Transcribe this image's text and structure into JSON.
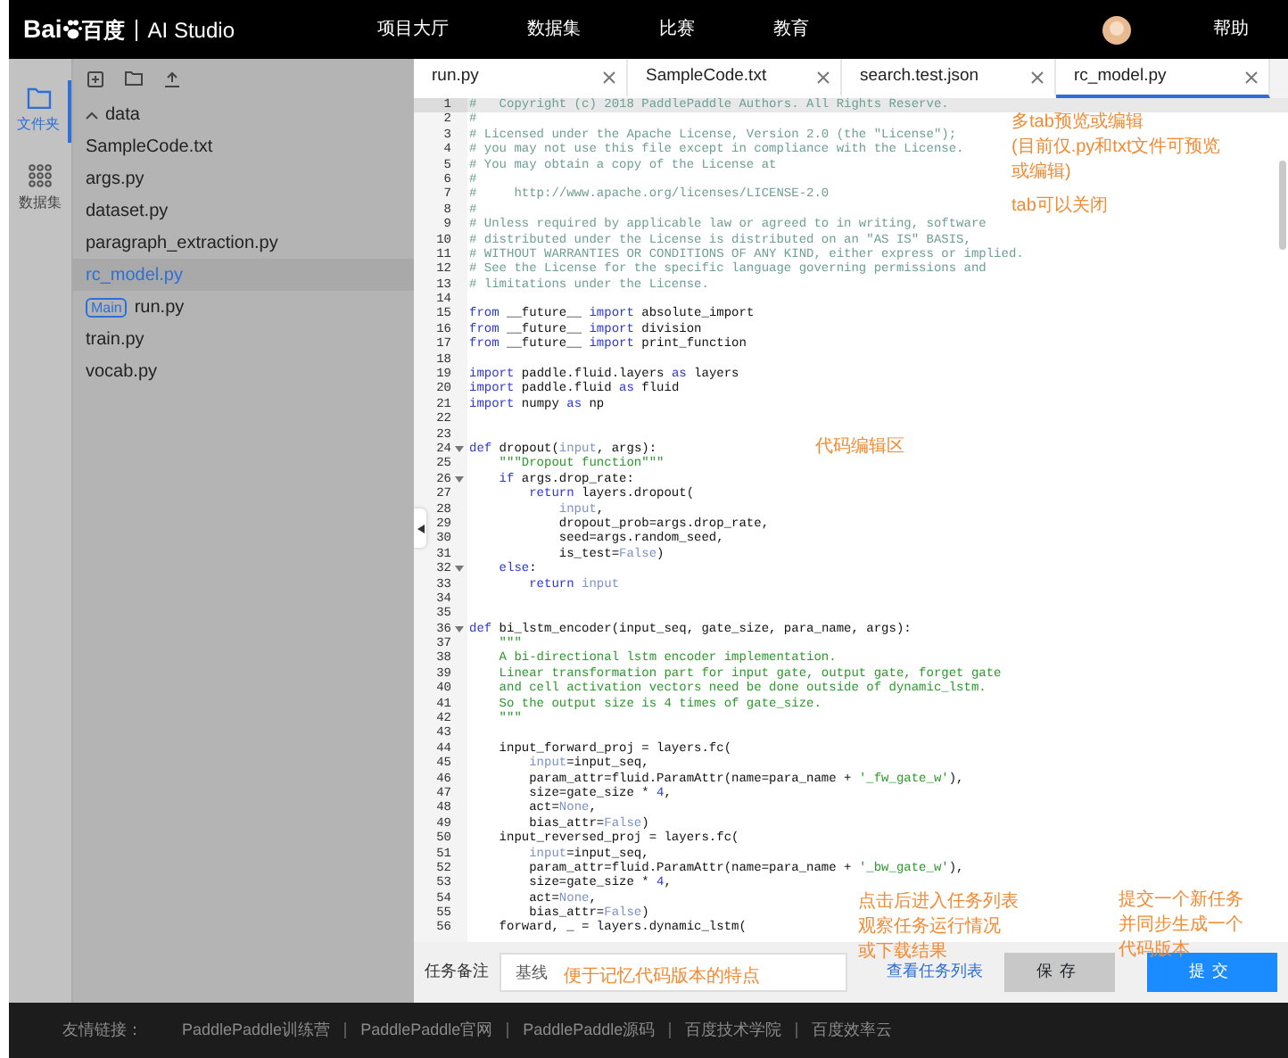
{
  "topbar": {
    "logo": {
      "brand": "Bai",
      "brand_cn": "百度",
      "product": "AI Studio"
    },
    "nav": [
      "项目大厅",
      "数据集",
      "比赛",
      "教育"
    ],
    "help": "帮助"
  },
  "rail": [
    {
      "label": "文件夹",
      "selected": true
    },
    {
      "label": "数据集",
      "selected": false
    }
  ],
  "file_tree": [
    {
      "name": "data",
      "kind": "folder",
      "expanded": true,
      "selected": false
    },
    {
      "name": "SampleCode.txt",
      "kind": "file",
      "selected": false
    },
    {
      "name": "args.py",
      "kind": "file",
      "selected": false
    },
    {
      "name": "dataset.py",
      "kind": "file",
      "selected": false
    },
    {
      "name": "paragraph_extraction.py",
      "kind": "file",
      "selected": false
    },
    {
      "name": "rc_model.py",
      "kind": "file",
      "selected": true
    },
    {
      "name": "run.py",
      "kind": "file",
      "badge": "Main",
      "selected": false
    },
    {
      "name": "train.py",
      "kind": "file",
      "selected": false
    },
    {
      "name": "vocab.py",
      "kind": "file",
      "selected": false
    }
  ],
  "tabs": [
    {
      "label": "run.py",
      "selected": false
    },
    {
      "label": "SampleCode.txt",
      "selected": false
    },
    {
      "label": "search.test.json",
      "selected": false
    },
    {
      "label": "rc_model.py",
      "selected": true
    }
  ],
  "code_lines": [
    {
      "n": "1",
      "active": true,
      "foldable": false,
      "tokens": [
        {
          "kind": "comment",
          "text": "#   Copyright (c) 2018 PaddlePaddle Authors. All Rights Reserve."
        }
      ]
    },
    {
      "n": "2",
      "active": false,
      "foldable": false,
      "tokens": [
        {
          "kind": "comment",
          "text": "#"
        }
      ]
    },
    {
      "n": "3",
      "active": false,
      "foldable": false,
      "tokens": [
        {
          "kind": "comment",
          "text": "# Licensed under the Apache License, Version 2.0 (the \"License\");"
        }
      ]
    },
    {
      "n": "4",
      "active": false,
      "foldable": false,
      "tokens": [
        {
          "kind": "comment",
          "text": "# you may not use this file except in compliance with the License."
        }
      ]
    },
    {
      "n": "5",
      "active": false,
      "foldable": false,
      "tokens": [
        {
          "kind": "comment",
          "text": "# You may obtain a copy of the License at"
        }
      ]
    },
    {
      "n": "6",
      "active": false,
      "foldable": false,
      "tokens": [
        {
          "kind": "comment",
          "text": "#"
        }
      ]
    },
    {
      "n": "7",
      "active": false,
      "foldable": false,
      "tokens": [
        {
          "kind": "comment",
          "text": "#     http://www.apache.org/licenses/LICENSE-2.0"
        }
      ]
    },
    {
      "n": "8",
      "active": false,
      "foldable": false,
      "tokens": [
        {
          "kind": "comment",
          "text": "#"
        }
      ]
    },
    {
      "n": "9",
      "active": false,
      "foldable": false,
      "tokens": [
        {
          "kind": "comment",
          "text": "# Unless required by applicable law or agreed to in writing, software"
        }
      ]
    },
    {
      "n": "10",
      "active": false,
      "foldable": false,
      "tokens": [
        {
          "kind": "comment",
          "text": "# distributed under the License is distributed on an \"AS IS\" BASIS,"
        }
      ]
    },
    {
      "n": "11",
      "active": false,
      "foldable": false,
      "tokens": [
        {
          "kind": "comment",
          "text": "# WITHOUT WARRANTIES OR CONDITIONS OF ANY KIND, either express or implied."
        }
      ]
    },
    {
      "n": "12",
      "active": false,
      "foldable": false,
      "tokens": [
        {
          "kind": "comment",
          "text": "# See the License for the specific language governing permissions and"
        }
      ]
    },
    {
      "n": "13",
      "active": false,
      "foldable": false,
      "tokens": [
        {
          "kind": "comment",
          "text": "# limitations under the License."
        }
      ]
    },
    {
      "n": "14",
      "active": false,
      "foldable": false
    },
    {
      "n": "15",
      "active": false,
      "foldable": false,
      "tokens": [
        {
          "kind": "keyword",
          "text": "from"
        },
        {
          "kind": "plain",
          "text": " __future__ "
        },
        {
          "kind": "keyword",
          "text": "import"
        },
        {
          "kind": "plain",
          "text": " absolute_import"
        }
      ]
    },
    {
      "n": "16",
      "active": false,
      "foldable": false,
      "tokens": [
        {
          "kind": "keyword",
          "text": "from"
        },
        {
          "kind": "plain",
          "text": " __future__ "
        },
        {
          "kind": "keyword",
          "text": "import"
        },
        {
          "kind": "plain",
          "text": " division"
        }
      ]
    },
    {
      "n": "17",
      "active": false,
      "foldable": false,
      "tokens": [
        {
          "kind": "keyword",
          "text": "from"
        },
        {
          "kind": "plain",
          "text": " __future__ "
        },
        {
          "kind": "keyword",
          "text": "import"
        },
        {
          "kind": "plain",
          "text": " print_function"
        }
      ]
    },
    {
      "n": "18",
      "active": false,
      "foldable": false
    },
    {
      "n": "19",
      "active": false,
      "foldable": false,
      "tokens": [
        {
          "kind": "keyword",
          "text": "import"
        },
        {
          "kind": "plain",
          "text": " paddle.fluid.layers "
        },
        {
          "kind": "keyword",
          "text": "as"
        },
        {
          "kind": "plain",
          "text": " layers"
        }
      ]
    },
    {
      "n": "20",
      "active": false,
      "foldable": false,
      "tokens": [
        {
          "kind": "keyword",
          "text": "import"
        },
        {
          "kind": "plain",
          "text": " paddle.fluid "
        },
        {
          "kind": "keyword",
          "text": "as"
        },
        {
          "kind": "plain",
          "text": " fluid"
        }
      ]
    },
    {
      "n": "21",
      "active": false,
      "foldable": false,
      "tokens": [
        {
          "kind": "keyword",
          "text": "import"
        },
        {
          "kind": "plain",
          "text": " numpy "
        },
        {
          "kind": "keyword",
          "text": "as"
        },
        {
          "kind": "plain",
          "text": " np"
        }
      ]
    },
    {
      "n": "22",
      "active": false,
      "foldable": false
    },
    {
      "n": "23",
      "active": false,
      "foldable": false
    },
    {
      "n": "24",
      "active": false,
      "foldable": true,
      "tokens": [
        {
          "kind": "keyword",
          "text": "def"
        },
        {
          "kind": "plain",
          "text": " dropout("
        },
        {
          "kind": "builtin",
          "text": "input"
        },
        {
          "kind": "plain",
          "text": ", args):"
        }
      ]
    },
    {
      "n": "25",
      "active": false,
      "foldable": false,
      "tokens": [
        {
          "kind": "string",
          "text": "    \"\"\"Dropout function\"\"\""
        }
      ]
    },
    {
      "n": "26",
      "active": false,
      "foldable": true,
      "tokens": [
        {
          "kind": "keyword",
          "text": "    if"
        },
        {
          "kind": "plain",
          "text": " args.drop_rate:"
        }
      ]
    },
    {
      "n": "27",
      "active": false,
      "foldable": false,
      "tokens": [
        {
          "kind": "keyword",
          "text": "        return"
        },
        {
          "kind": "plain",
          "text": " layers.dropout("
        }
      ]
    },
    {
      "n": "28",
      "active": false,
      "foldable": false,
      "tokens": [
        {
          "kind": "builtin",
          "text": "            input"
        },
        {
          "kind": "plain",
          "text": ","
        }
      ]
    },
    {
      "n": "29",
      "active": false,
      "foldable": false,
      "tokens": [
        {
          "kind": "plain",
          "text": "            dropout_prob=args.drop_rate,"
        }
      ]
    },
    {
      "n": "30",
      "active": false,
      "foldable": false,
      "tokens": [
        {
          "kind": "plain",
          "text": "            seed=args.random_seed,"
        }
      ]
    },
    {
      "n": "31",
      "active": false,
      "foldable": false,
      "tokens": [
        {
          "kind": "plain",
          "text": "            is_test="
        },
        {
          "kind": "builtin",
          "text": "False"
        },
        {
          "kind": "plain",
          "text": ")"
        }
      ]
    },
    {
      "n": "32",
      "active": false,
      "foldable": true,
      "tokens": [
        {
          "kind": "keyword",
          "text": "    else"
        },
        {
          "kind": "plain",
          "text": ":"
        }
      ]
    },
    {
      "n": "33",
      "active": false,
      "foldable": false,
      "tokens": [
        {
          "kind": "keyword",
          "text": "        return "
        },
        {
          "kind": "builtin",
          "text": "input"
        }
      ]
    },
    {
      "n": "34",
      "active": false,
      "foldable": false
    },
    {
      "n": "35",
      "active": false,
      "foldable": false
    },
    {
      "n": "36",
      "active": false,
      "foldable": true,
      "tokens": [
        {
          "kind": "keyword",
          "text": "def"
        },
        {
          "kind": "plain",
          "text": " bi_lstm_encoder(input_seq, gate_size, para_name, args):"
        }
      ]
    },
    {
      "n": "37",
      "active": false,
      "foldable": false,
      "tokens": [
        {
          "kind": "string",
          "text": "    \"\"\""
        }
      ]
    },
    {
      "n": "38",
      "active": false,
      "foldable": false,
      "tokens": [
        {
          "kind": "string",
          "text": "    A bi-directional lstm encoder implementation."
        }
      ]
    },
    {
      "n": "39",
      "active": false,
      "foldable": false,
      "tokens": [
        {
          "kind": "string",
          "text": "    Linear transformation part for input gate, output gate, forget gate"
        }
      ]
    },
    {
      "n": "40",
      "active": false,
      "foldable": false,
      "tokens": [
        {
          "kind": "string",
          "text": "    and cell activation vectors need be done outside of dynamic_lstm."
        }
      ]
    },
    {
      "n": "41",
      "active": false,
      "foldable": false,
      "tokens": [
        {
          "kind": "string",
          "text": "    So the output size is 4 times of gate_size."
        }
      ]
    },
    {
      "n": "42",
      "active": false,
      "foldable": false,
      "tokens": [
        {
          "kind": "string",
          "text": "    \"\"\""
        }
      ]
    },
    {
      "n": "43",
      "active": false,
      "foldable": false
    },
    {
      "n": "44",
      "active": false,
      "foldable": false,
      "tokens": [
        {
          "kind": "plain",
          "text": "    input_forward_proj = layers.fc("
        }
      ]
    },
    {
      "n": "45",
      "active": false,
      "foldable": false,
      "tokens": [
        {
          "kind": "builtin",
          "text": "        input"
        },
        {
          "kind": "plain",
          "text": "=input_seq,"
        }
      ]
    },
    {
      "n": "46",
      "active": false,
      "foldable": false,
      "tokens": [
        {
          "kind": "plain",
          "text": "        param_attr=fluid.ParamAttr(name=para_name + "
        },
        {
          "kind": "string",
          "text": "'_fw_gate_w'"
        },
        {
          "kind": "plain",
          "text": "),"
        }
      ]
    },
    {
      "n": "47",
      "active": false,
      "foldable": false,
      "tokens": [
        {
          "kind": "plain",
          "text": "        size=gate_size * "
        },
        {
          "kind": "number",
          "text": "4"
        },
        {
          "kind": "plain",
          "text": ","
        }
      ]
    },
    {
      "n": "48",
      "active": false,
      "foldable": false,
      "tokens": [
        {
          "kind": "plain",
          "text": "        act="
        },
        {
          "kind": "builtin",
          "text": "None"
        },
        {
          "kind": "plain",
          "text": ","
        }
      ]
    },
    {
      "n": "49",
      "active": false,
      "foldable": false,
      "tokens": [
        {
          "kind": "plain",
          "text": "        bias_attr="
        },
        {
          "kind": "builtin",
          "text": "False"
        },
        {
          "kind": "plain",
          "text": ")"
        }
      ]
    },
    {
      "n": "50",
      "active": false,
      "foldable": false,
      "tokens": [
        {
          "kind": "plain",
          "text": "    input_reversed_proj = layers.fc("
        }
      ]
    },
    {
      "n": "51",
      "active": false,
      "foldable": false,
      "tokens": [
        {
          "kind": "builtin",
          "text": "        input"
        },
        {
          "kind": "plain",
          "text": "=input_seq,"
        }
      ]
    },
    {
      "n": "52",
      "active": false,
      "foldable": false,
      "tokens": [
        {
          "kind": "plain",
          "text": "        param_attr=fluid.ParamAttr(name=para_name + "
        },
        {
          "kind": "string",
          "text": "'_bw_gate_w'"
        },
        {
          "kind": "plain",
          "text": "),"
        }
      ]
    },
    {
      "n": "53",
      "active": false,
      "foldable": false,
      "tokens": [
        {
          "kind": "plain",
          "text": "        size=gate_size * "
        },
        {
          "kind": "number",
          "text": "4"
        },
        {
          "kind": "plain",
          "text": ","
        }
      ]
    },
    {
      "n": "54",
      "active": false,
      "foldable": false,
      "tokens": [
        {
          "kind": "plain",
          "text": "        act="
        },
        {
          "kind": "builtin",
          "text": "None"
        },
        {
          "kind": "plain",
          "text": ","
        }
      ]
    },
    {
      "n": "55",
      "active": false,
      "foldable": false,
      "tokens": [
        {
          "kind": "plain",
          "text": "        bias_attr="
        },
        {
          "kind": "builtin",
          "text": "False"
        },
        {
          "kind": "plain",
          "text": ")"
        }
      ]
    },
    {
      "n": "56",
      "active": false,
      "foldable": false,
      "tokens": [
        {
          "kind": "plain",
          "text": "    forward, _ = layers.dynamic_lstm("
        }
      ]
    }
  ],
  "task_bar": {
    "label": "任务备注",
    "note_value": "基线",
    "link": "查看任务列表",
    "buttons": [
      {
        "label": "保存",
        "kind": "save",
        "disabled": true
      },
      {
        "label": "提交",
        "kind": "submit",
        "disabled": false
      }
    ]
  },
  "footer": {
    "label": "友情链接：",
    "links": [
      "PaddlePaddle训练营",
      "PaddlePaddle官网",
      "PaddlePaddle源码",
      "百度技术学院",
      "百度效率云"
    ]
  },
  "annotations": [
    {
      "lines": [
        "多tab预览或编辑",
        "(目前仅.py和txt文件可预览",
        "或编辑)"
      ]
    },
    {
      "lines": [
        "tab可以关闭"
      ]
    },
    {
      "lines": [
        "代码编辑区"
      ]
    },
    {
      "lines": [
        "点击后进入任务列表",
        "观察任务运行情况",
        "或下载结果"
      ]
    },
    {
      "lines": [
        "提交一个新任务",
        "并同步生成一个",
        "代码版本"
      ]
    },
    {
      "lines": [
        "便于记忆代码版本的特点"
      ]
    }
  ]
}
